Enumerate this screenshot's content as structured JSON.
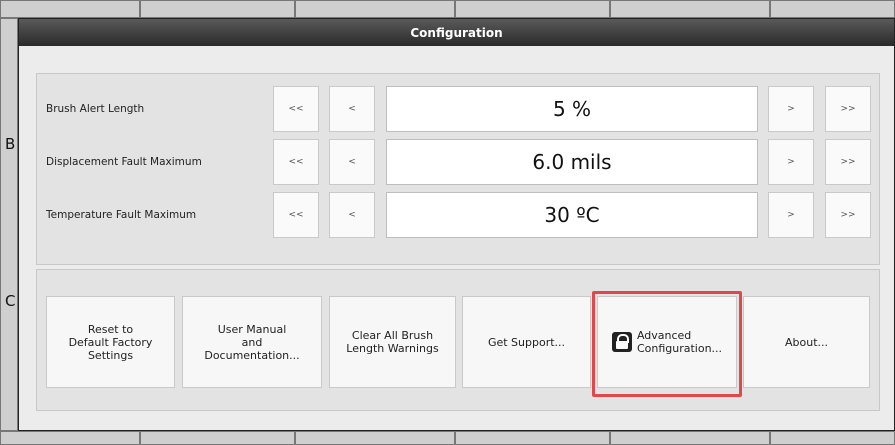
{
  "dialog": {
    "title": "Configuration"
  },
  "background": {
    "letters": [
      "B",
      "C"
    ]
  },
  "step_buttons": {
    "big_dec": "<<",
    "dec": "<",
    "inc": ">",
    "big_inc": ">>"
  },
  "settings": [
    {
      "label": "Brush Alert Length",
      "value": "5 %"
    },
    {
      "label": "Displacement Fault Maximum",
      "value": "6.0 mils"
    },
    {
      "label": "Temperature Fault Maximum",
      "value": "30 ºC"
    }
  ],
  "actions": {
    "reset": "Reset to\nDefault Factory\nSettings",
    "manual": "User Manual\nand\nDocumentation...",
    "clear": "Clear All Brush\nLength Warnings",
    "support": "Get Support...",
    "advanced": "Advanced\nConfiguration...",
    "about": "About..."
  },
  "colors": {
    "highlight": "#e0494b",
    "titlebar": "#2a2a2a"
  }
}
